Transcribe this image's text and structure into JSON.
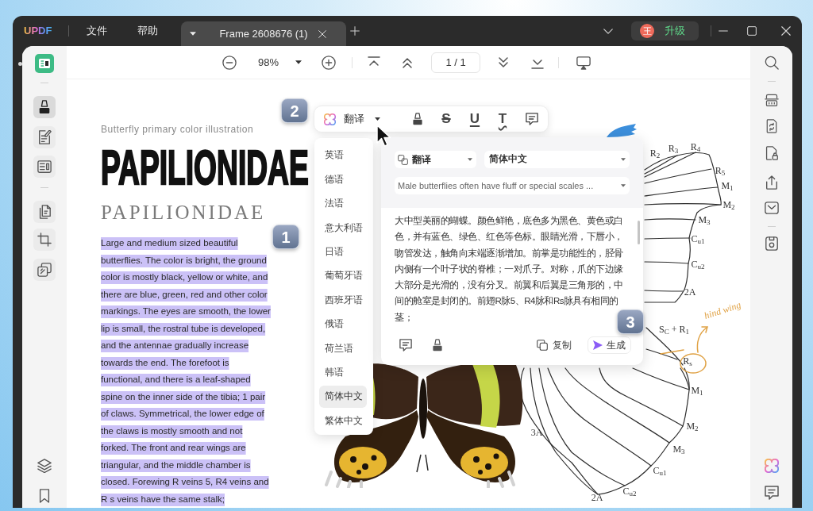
{
  "window": {
    "logo": "UPDF",
    "menu": [
      {
        "label": "文件"
      },
      {
        "label": "帮助"
      }
    ],
    "tabs": [
      {
        "title": "Frame 2608676 (1)",
        "selected": true
      }
    ],
    "account": {
      "avatar": "王",
      "upgrade": "升级"
    }
  },
  "left_sidebar": {
    "tool_groups": [
      [
        {
          "kind": "highlight",
          "selected": true
        },
        {
          "kind": "edit",
          "selected": false
        },
        {
          "kind": "form",
          "selected": false
        }
      ],
      [
        {
          "kind": "pages",
          "selected": false
        },
        {
          "kind": "crop",
          "selected": false
        },
        {
          "kind": "duplicate",
          "selected": false
        }
      ]
    ]
  },
  "toolbar": {
    "zoom": "98%",
    "page": "1 / 1"
  },
  "document": {
    "subtitle": "Butterfly primary color illustration",
    "title": "PAPILIONIDAE",
    "title_serif": "PAPILIONIDAE",
    "paragraph": {
      "selected": true,
      "lines": [
        "Large and medium sized beautiful",
        "butterflies. The color is bright, the ground",
        "color is mostly black, yellow or white, and",
        "there are blue, green, red and other color",
        "markings. The eyes are smooth, the lower",
        "lip is small, the rostral tube is developed,",
        "and the antennae gradually increase",
        "towards the end. The forefoot is",
        "functional, and there is a leaf-shaped",
        "spine on the inner side of the tibia; 1 pair",
        "of claws. Symmetrical, the lower edge of",
        "the claws is mostly smooth and not",
        "forked. The front and rear wings are",
        "triangular, and the middle chamber is",
        "closed. Forewing R veins 5, R4 veins and",
        "R s veins have the same stalk;"
      ]
    },
    "forewing_labels": [
      "R$_{2}$",
      "R$_{3}$",
      "R$_{4}$",
      "R$_{5}$",
      "M$_{1}$",
      "M$_{2}$",
      "M$_{3}$",
      "C$_{u1}$",
      "C$_{u2}$",
      "2A"
    ],
    "hindwing_labels": [
      "S$_{C}$ + R$_{1}$",
      "R$_{s}$",
      "M$_{1}$",
      "M$_{2}$",
      "M$_{3}$",
      "C$_{u1}$",
      "C$_{u2}$",
      "2A",
      "3A"
    ],
    "note": "hind wing"
  },
  "annotation_toolbar": {
    "translate": "翻译",
    "tools": [
      {
        "kind": "highlight"
      },
      {
        "kind": "strikethrough",
        "glyph": "S"
      },
      {
        "kind": "underline",
        "glyph": "U"
      },
      {
        "kind": "squiggly",
        "glyph": "T"
      },
      {
        "kind": "comment"
      }
    ]
  },
  "language_menu": [
    {
      "label": "英语",
      "selected": false
    },
    {
      "label": "德语",
      "selected": false
    },
    {
      "label": "法语",
      "selected": false
    },
    {
      "label": "意大利语",
      "selected": false
    },
    {
      "label": "日语",
      "selected": false
    },
    {
      "label": "葡萄牙语",
      "selected": false
    },
    {
      "label": "西班牙语",
      "selected": false
    },
    {
      "label": "俄语",
      "selected": false
    },
    {
      "label": "荷兰语",
      "selected": false
    },
    {
      "label": "韩语",
      "selected": false
    },
    {
      "label": "简体中文",
      "selected": true
    },
    {
      "label": "繁体中文",
      "selected": false
    }
  ],
  "translate_panel": {
    "mode": "翻译",
    "target_language": "简体中文",
    "source": "Male butterflies often have fluff or special scales ...",
    "output": "大中型美丽的蝴蝶。颜色鲜艳，底色多为黑色、黄色或白色，并有蓝色、绿色、红色等色标。眼睛光滑，下唇小，吻管发达，触角向末端逐渐增加。前掌是功能性的，胫骨内侧有一个叶子状的脊椎；一对爪子。对称，爪的下边缘大部分是光滑的，没有分叉。前翼和后翼是三角形的，中间的舱室是封闭的。前翅R脉5、R4脉和Rs脉具有相同的茎；",
    "copy": "复制",
    "generate": "生成"
  },
  "step_badges": [
    "1",
    "2",
    "3"
  ]
}
